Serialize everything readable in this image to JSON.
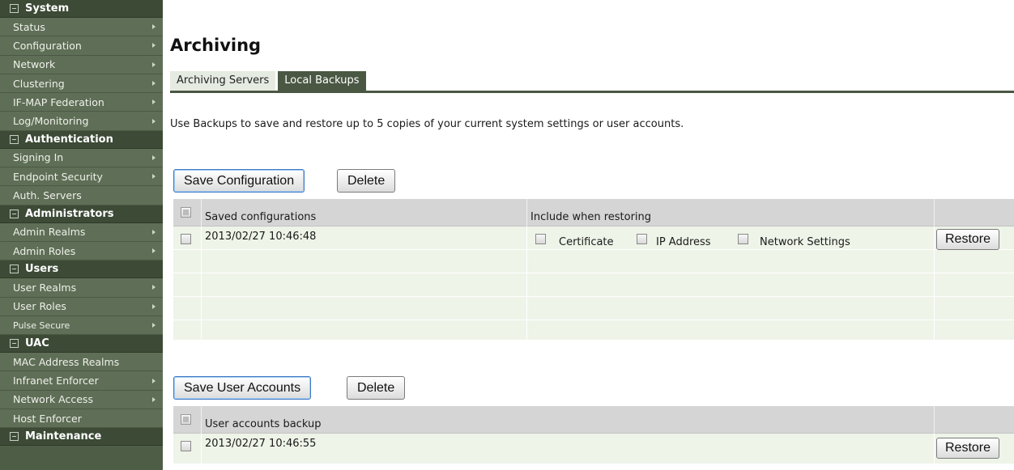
{
  "sidebar": {
    "sections": [
      {
        "title": "System",
        "items": [
          {
            "label": "Status",
            "arrow": true
          },
          {
            "label": "Configuration",
            "arrow": true
          },
          {
            "label": "Network",
            "arrow": true
          },
          {
            "label": "Clustering",
            "arrow": true
          },
          {
            "label": "IF-MAP Federation",
            "arrow": true
          },
          {
            "label": "Log/Monitoring",
            "arrow": true
          }
        ]
      },
      {
        "title": "Authentication",
        "items": [
          {
            "label": "Signing In",
            "arrow": true
          },
          {
            "label": "Endpoint Security",
            "arrow": true
          },
          {
            "label": "Auth. Servers",
            "arrow": false
          }
        ]
      },
      {
        "title": "Administrators",
        "items": [
          {
            "label": "Admin Realms",
            "arrow": true
          },
          {
            "label": "Admin Roles",
            "arrow": true
          }
        ]
      },
      {
        "title": "Users",
        "items": [
          {
            "label": "User Realms",
            "arrow": true
          },
          {
            "label": "User Roles",
            "arrow": true
          },
          {
            "label": "Pulse Secure",
            "arrow": true,
            "small": true
          }
        ]
      },
      {
        "title": "UAC",
        "items": [
          {
            "label": "MAC Address Realms",
            "arrow": false
          },
          {
            "label": "Infranet Enforcer",
            "arrow": true
          },
          {
            "label": "Network Access",
            "arrow": true
          },
          {
            "label": "Host Enforcer",
            "arrow": false
          }
        ]
      },
      {
        "title": "Maintenance",
        "items": []
      }
    ]
  },
  "page": {
    "title": "Archiving",
    "tabs": [
      "Archiving Servers",
      "Local Backups"
    ],
    "active_tab": "Local Backups",
    "description": "Use Backups to save and restore up to 5 copies of your current system settings or user accounts."
  },
  "config": {
    "save_label": "Save Configuration",
    "delete_label": "Delete",
    "col_saved": "Saved configurations",
    "col_include": "Include when restoring",
    "rows": [
      {
        "date": "2013/02/27 10:46:48",
        "opt_certificate": "Certificate",
        "opt_ip": "IP Address",
        "opt_network": "Network Settings",
        "restore": "Restore"
      }
    ]
  },
  "accounts": {
    "save_label": "Save User Accounts",
    "delete_label": "Delete",
    "col_backup": "User accounts backup",
    "rows": [
      {
        "date": "2013/02/27 10:46:55",
        "restore": "Restore"
      }
    ]
  },
  "colors": {
    "sidebar_section": "#3c4a36",
    "sidebar_item": "#5f6e56",
    "tab_active": "#4a5743",
    "row_bg": "#eef4e8",
    "header_bg": "#d5d5d5"
  }
}
